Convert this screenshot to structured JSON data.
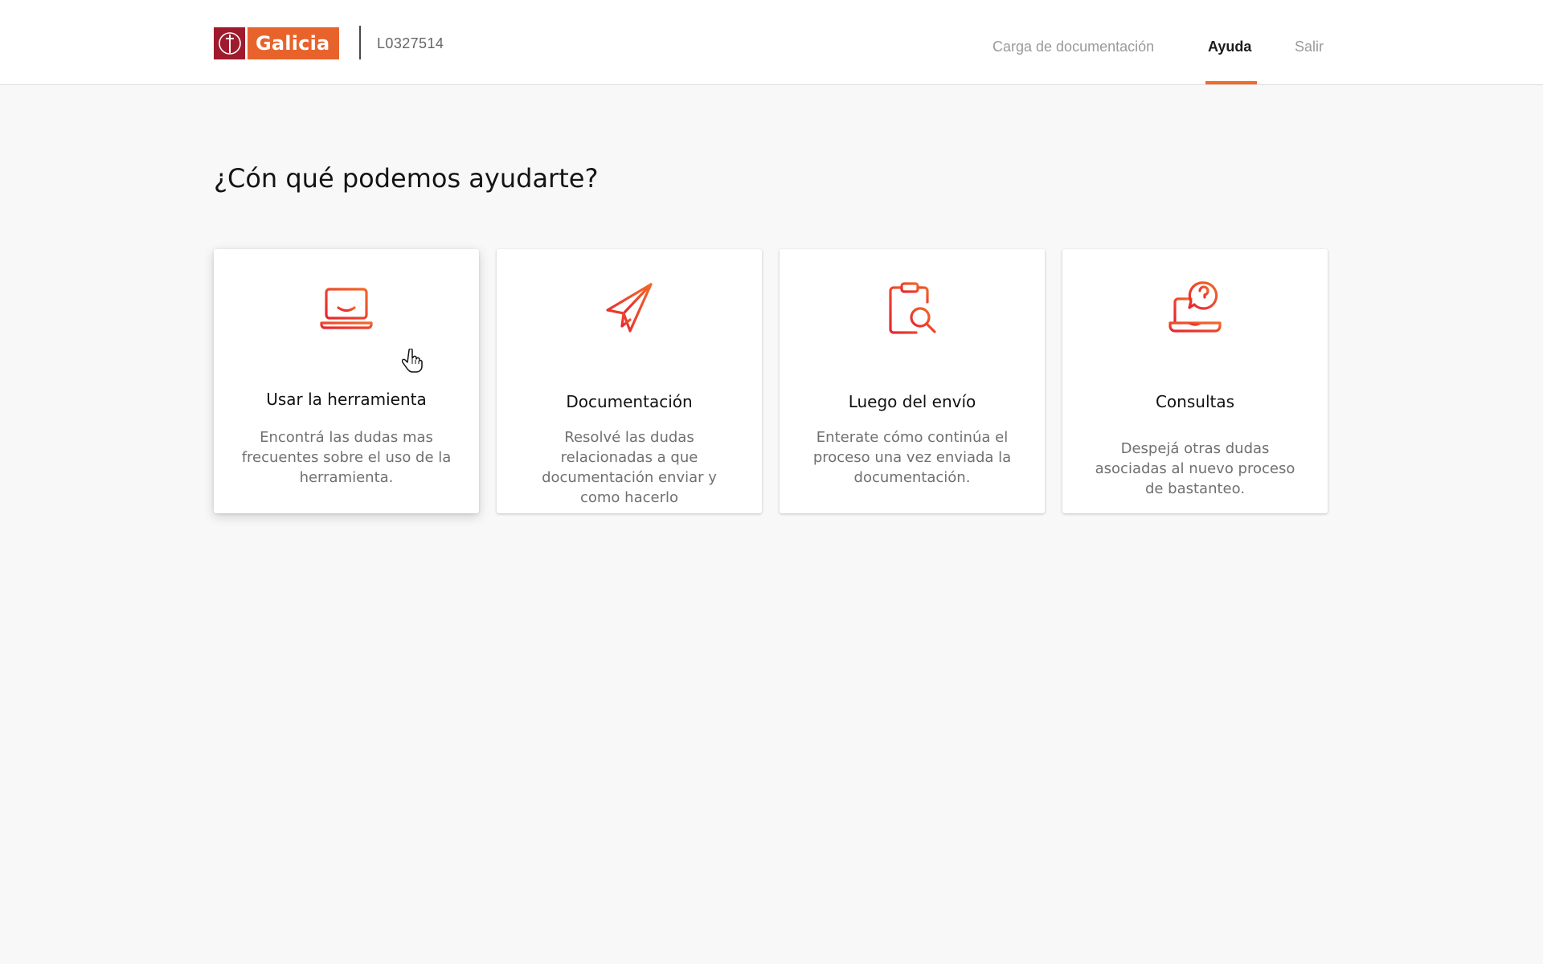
{
  "header": {
    "logo": {
      "brand": "Galicia",
      "colors": {
        "mark": "#9f1a2c",
        "word": "#e8632b"
      }
    },
    "user_code": "L0327514",
    "nav": [
      {
        "label": "Carga de documentación",
        "active": false
      },
      {
        "label": "Ayuda",
        "active": true
      },
      {
        "label": "Salir",
        "active": false
      }
    ],
    "accent_color": "#f06a2a"
  },
  "main": {
    "title": "¿Cón qué podemos ayudarte?",
    "cards": [
      {
        "icon": "laptop-smile-icon",
        "title": "Usar la herramienta",
        "description": "Encontrá las dudas mas frecuentes sobre el uso de la herramienta.",
        "hovered": true
      },
      {
        "icon": "paper-plane-icon",
        "title": "Documentación",
        "description": "Resolvé las dudas relacionadas a que documentación enviar y como hacerlo",
        "hovered": false
      },
      {
        "icon": "clipboard-search-icon",
        "title": "Luego del envío",
        "description": "Enterate cómo continúa el proceso una vez enviada la documentación.",
        "hovered": false
      },
      {
        "icon": "laptop-question-icon",
        "title": "Consultas",
        "description": "Despejá otras dudas asociadas al nuevo proceso de bastanteo.",
        "hovered": false
      }
    ],
    "icon_gradient": {
      "from": "#e8242f",
      "to": "#f06a2a"
    }
  }
}
